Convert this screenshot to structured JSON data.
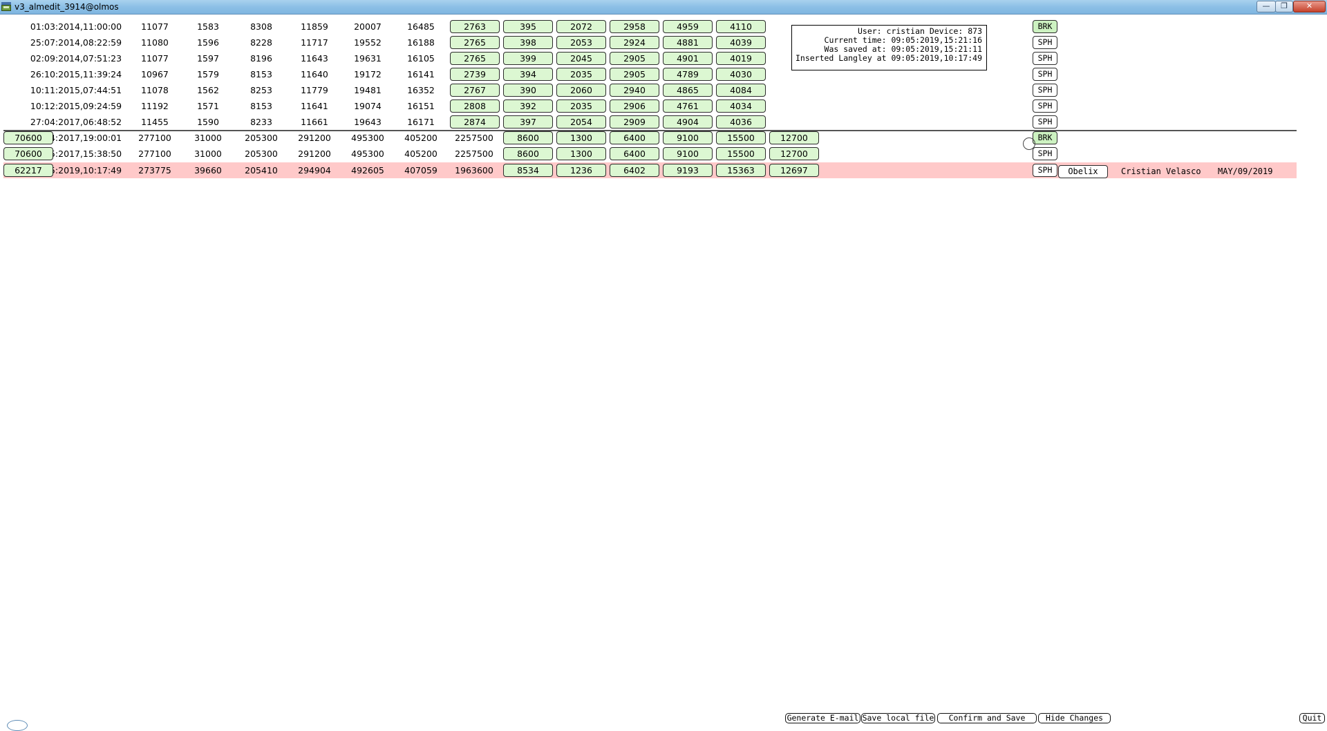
{
  "window": {
    "title": "v3_almedit_3914@olmos",
    "minimize_glyph": "—",
    "maximize_glyph": "❐",
    "close_glyph": "✕"
  },
  "rows": [
    {
      "date": "01:03:2014,11:00:00",
      "nums": [
        "11077",
        "1583",
        "8308",
        "11859",
        "20007",
        "16485"
      ],
      "extra": "",
      "green": [
        "2763",
        "395",
        "2072",
        "2958",
        "4959",
        "4110"
      ],
      "tag": "BRK"
    },
    {
      "date": "25:07:2014,08:22:59",
      "nums": [
        "11080",
        "1596",
        "8228",
        "11717",
        "19552",
        "16188"
      ],
      "extra": "",
      "green": [
        "2765",
        "398",
        "2053",
        "2924",
        "4881",
        "4039"
      ],
      "tag": "SPH"
    },
    {
      "date": "02:09:2014,07:51:23",
      "nums": [
        "11077",
        "1597",
        "8196",
        "11643",
        "19631",
        "16105"
      ],
      "extra": "",
      "green": [
        "2765",
        "399",
        "2045",
        "2905",
        "4901",
        "4019"
      ],
      "tag": "SPH"
    },
    {
      "date": "26:10:2015,11:39:24",
      "nums": [
        "10967",
        "1579",
        "8153",
        "11640",
        "19172",
        "16141"
      ],
      "extra": "",
      "green": [
        "2739",
        "394",
        "2035",
        "2905",
        "4789",
        "4030"
      ],
      "tag": "SPH"
    },
    {
      "date": "10:11:2015,07:44:51",
      "nums": [
        "11078",
        "1562",
        "8253",
        "11779",
        "19481",
        "16352"
      ],
      "extra": "",
      "green": [
        "2767",
        "390",
        "2060",
        "2940",
        "4865",
        "4084"
      ],
      "tag": "SPH"
    },
    {
      "date": "10:12:2015,09:24:59",
      "nums": [
        "11192",
        "1571",
        "8153",
        "11641",
        "19074",
        "16151"
      ],
      "extra": "",
      "green": [
        "2808",
        "392",
        "2035",
        "2906",
        "4761",
        "4034"
      ],
      "tag": "SPH"
    },
    {
      "date": "27:04:2017,06:48:52",
      "nums": [
        "11455",
        "1590",
        "8233",
        "11661",
        "19643",
        "16171"
      ],
      "extra": "",
      "green": [
        "2874",
        "397",
        "2054",
        "2909",
        "4904",
        "4036"
      ],
      "tag": "SPH"
    },
    {
      "date": "27:04:2017,19:00:01",
      "nums": [
        "277100",
        "31000",
        "205300",
        "291200",
        "495300",
        "405200"
      ],
      "extra": "2257500",
      "green": [
        "8600",
        "1300",
        "6400",
        "9100",
        "15500",
        "12700",
        "70600"
      ],
      "tag": "BRK"
    },
    {
      "date": "22:05:2017,15:38:50",
      "nums": [
        "277100",
        "31000",
        "205300",
        "291200",
        "495300",
        "405200"
      ],
      "extra": "2257500",
      "green": [
        "8600",
        "1300",
        "6400",
        "9100",
        "15500",
        "12700",
        "70600"
      ],
      "tag": "SPH"
    },
    {
      "date": "09:05:2019,10:17:49",
      "nums": [
        "273775",
        "39660",
        "205410",
        "294904",
        "492605",
        "407059"
      ],
      "extra": "1963600",
      "green": [
        "8534",
        "1236",
        "6402",
        "9193",
        "15363",
        "12697",
        "62217"
      ],
      "tag": "SPH"
    }
  ],
  "highlight_row": {
    "operator_button": "Obelix",
    "user_name": "Cristian Velasco",
    "date": "MAY/09/2019"
  },
  "info_box": {
    "line1": "User: cristian Device: 873",
    "line2": "Current time: 09:05:2019,15:21:16",
    "line3": "Was saved at: 09:05:2019,15:21:11",
    "line4": "Inserted Langley at 09:05:2019,10:17:49"
  },
  "bottom_buttons": {
    "generate_email": "Generate E-mail",
    "save_local": "Save local file",
    "confirm_save": "Confirm and Save",
    "hide_changes": "Hide Changes",
    "quit": "Quit"
  },
  "colors": {
    "button_green": "#dcf7d2",
    "brk_green": "#cdf2c1",
    "highlight_row": "#ffc9c9",
    "titlebar": "#8cbfe6"
  }
}
